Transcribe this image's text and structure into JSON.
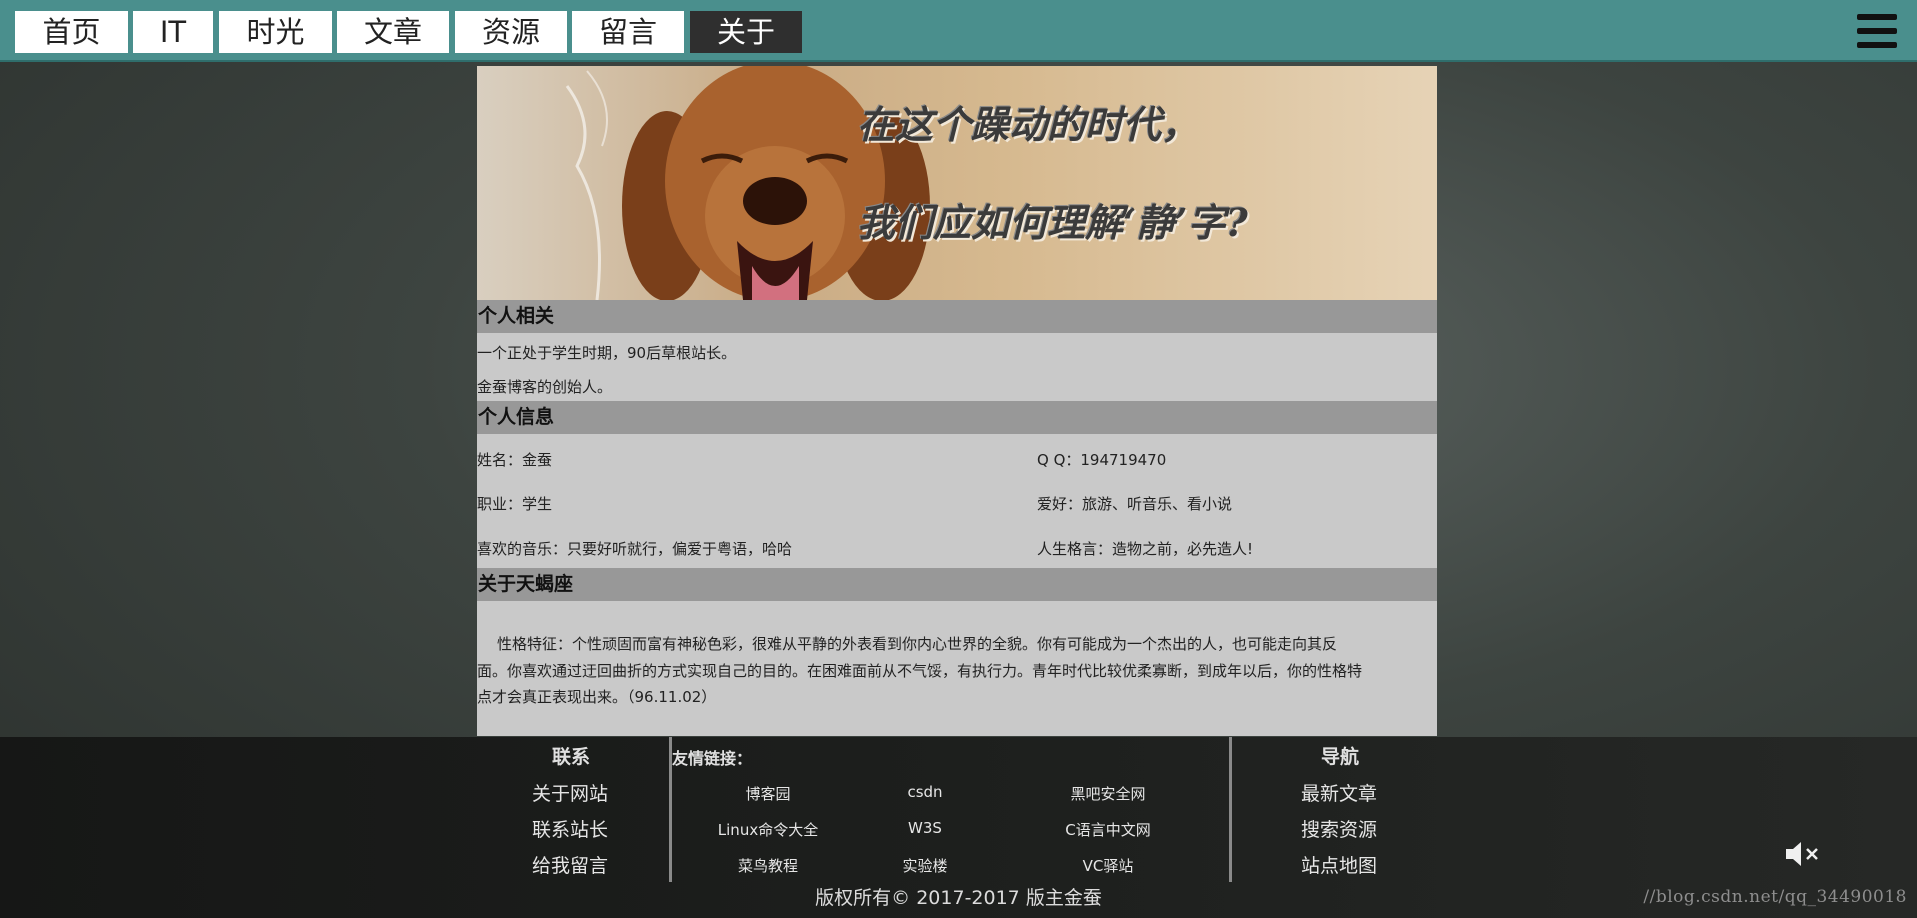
{
  "nav": {
    "items": [
      "首页",
      "IT",
      "时光",
      "文章",
      "资源",
      "留言",
      "关于"
    ],
    "active_index": 6
  },
  "banner": {
    "line1": "在这个躁动的时代，",
    "line2": "我们应如何理解‘静’字?"
  },
  "sections": {
    "personal": {
      "title": "个人相关",
      "line1": "一个正处于学生时期，90后草根站长。",
      "line2": "金蚕博客的创始人。"
    },
    "info": {
      "title": "个人信息",
      "name": "姓名：金蚕",
      "job": "职业：学生",
      "music": "喜欢的音乐：只要好听就行，偏爱于粤语，哈哈",
      "qq": "Q Q：194719470",
      "hobby": "爱好：旅游、听音乐、看小说",
      "motto": "人生格言：造物之前，必先造人!"
    },
    "scorpio": {
      "title": "关于天蝎座",
      "line1": "性格特征：个性顽固而富有神秘色彩，很难从平静的外表看到你内心世界的全貌。你有可能成为一个杰出的人，也可能走向其反",
      "line2": "面。你喜欢通过迂回曲折的方式实现自己的目的。在困难面前从不气馁，有执行力。青年时代比较优柔寡断，到成年以后，你的性格特",
      "line3": "点才会真正表现出来。（96.11.02）"
    }
  },
  "footer": {
    "contact": {
      "title": "联系",
      "links": [
        "关于网站",
        "联系站长",
        "给我留言"
      ]
    },
    "friends": {
      "title": "友情链接：",
      "links": [
        "博客园",
        "csdn",
        "黑吧安全网",
        "Linux命令大全",
        "W3S",
        "C语言中文网",
        "菜鸟教程",
        "实验楼",
        "VC驿站"
      ]
    },
    "navigation": {
      "title": "导航",
      "links": [
        "最新文章",
        "搜索资源",
        "站点地图"
      ]
    },
    "copyright": "版权所有© 2017-2017 版主金蚕"
  },
  "watermark": "//blog.csdn.net/qq_34490018",
  "icons": {
    "menu": "hamburger-menu-icon",
    "mute": "speaker-muted-icon"
  },
  "colors": {
    "topbar": "#4a8f8d",
    "active_nav": "#2f2f2f",
    "section_head": "#989898",
    "content_bg": "#c9c9c9"
  }
}
